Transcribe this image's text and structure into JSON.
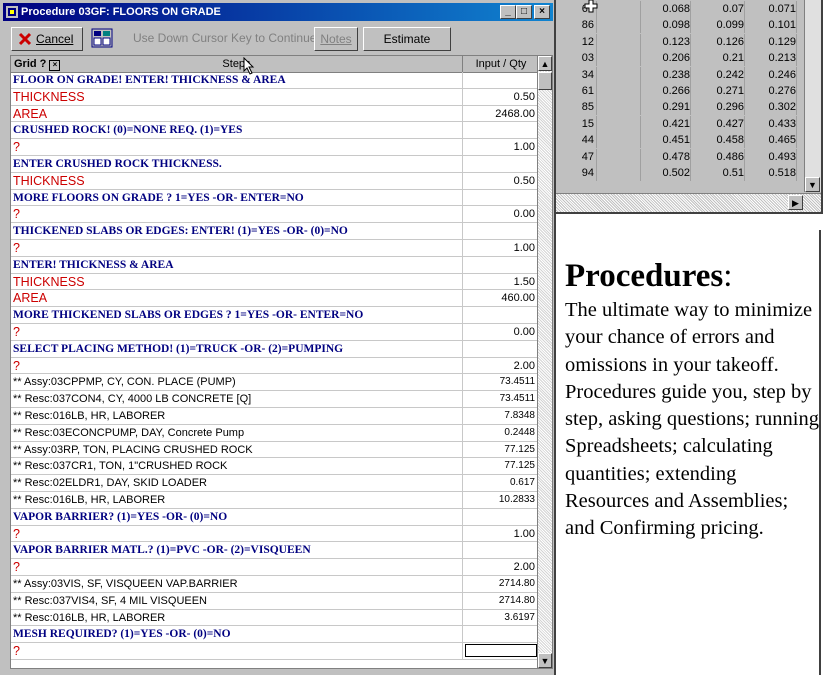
{
  "window": {
    "title": "Procedure 03GF: FLOORS ON GRADE",
    "min_label": "_",
    "max_label": "□",
    "close_label": "×"
  },
  "toolbar": {
    "cancel_label": "Cancel",
    "hint": "Use Down Cursor Key to Continue",
    "notes_label": "Notes",
    "estimate_update_label": "Estimate Update"
  },
  "grid": {
    "label": "Grid ?",
    "col_steps": "Steps",
    "col_qty": "Input / Qty",
    "rows": [
      {
        "type": "q",
        "step": "FLOOR ON GRADE!  ENTER! THICKNESS & AREA",
        "qty": ""
      },
      {
        "type": "r",
        "step": "THICKNESS",
        "qty": "0.50"
      },
      {
        "type": "r",
        "step": "AREA",
        "qty": "2468.00"
      },
      {
        "type": "q",
        "step": "CRUSHED ROCK!  (0)=NONE REQ.  (1)=YES",
        "qty": ""
      },
      {
        "type": "r",
        "step": "?",
        "qty": "1.00"
      },
      {
        "type": "q",
        "step": "ENTER CRUSHED ROCK THICKNESS.",
        "qty": ""
      },
      {
        "type": "r",
        "step": "THICKNESS",
        "qty": "0.50"
      },
      {
        "type": "q",
        "step": "MORE FLOORS ON GRADE ? 1=YES  -OR-  ENTER=NO",
        "qty": ""
      },
      {
        "type": "r",
        "step": "?",
        "qty": "0.00"
      },
      {
        "type": "q",
        "step": "THICKENED SLABS OR EDGES:  ENTER! (1)=YES   -OR-   (0)=NO",
        "qty": ""
      },
      {
        "type": "r",
        "step": "?",
        "qty": "1.00"
      },
      {
        "type": "q",
        "step": "ENTER!  THICKNESS & AREA",
        "qty": ""
      },
      {
        "type": "r",
        "step": "THICKNESS",
        "qty": "1.50"
      },
      {
        "type": "r",
        "step": "AREA",
        "qty": "460.00"
      },
      {
        "type": "q",
        "step": "MORE THICKENED SLABS OR EDGES ? 1=YES  -OR-  ENTER=NO",
        "qty": ""
      },
      {
        "type": "r",
        "step": "?",
        "qty": "0.00"
      },
      {
        "type": "q",
        "step": "SELECT PLACING METHOD!  (1)=TRUCK   -OR-   (2)=PUMPING",
        "qty": ""
      },
      {
        "type": "r",
        "step": "?",
        "qty": "2.00"
      },
      {
        "type": "a",
        "step": "** Assy:03CPPMP, CY, CON. PLACE (PUMP)",
        "qty": "73.4511"
      },
      {
        "type": "a",
        "step": "** Resc:037CON4, CY, 4000 LB CONCRETE [Q]",
        "qty": "73.4511"
      },
      {
        "type": "a",
        "step": "** Resc:016LB, HR, LABORER",
        "qty": "7.8348"
      },
      {
        "type": "a",
        "step": "** Resc:03ECONCPUMP, DAY, Concrete Pump",
        "qty": "0.2448"
      },
      {
        "type": "a",
        "step": "** Assy:03RP, TON, PLACING CRUSHED ROCK",
        "qty": "77.125"
      },
      {
        "type": "a",
        "step": "** Resc:037CR1, TON, 1\"CRUSHED ROCK",
        "qty": "77.125"
      },
      {
        "type": "a",
        "step": "** Resc:02ELDR1, DAY, SKID LOADER",
        "qty": "0.617"
      },
      {
        "type": "a",
        "step": "** Resc:016LB, HR, LABORER",
        "qty": "10.2833"
      },
      {
        "type": "q",
        "step": "VAPOR BARRIER?  (1)=YES   -OR-   (0)=NO",
        "qty": ""
      },
      {
        "type": "r",
        "step": "?",
        "qty": "1.00"
      },
      {
        "type": "q",
        "step": "VAPOR BARRIER MATL.?  (1)=PVC   -OR-   (2)=VISQUEEN",
        "qty": ""
      },
      {
        "type": "r",
        "step": "?",
        "qty": "2.00"
      },
      {
        "type": "a",
        "step": "** Assy:03VIS, SF, VISQUEEN VAP.BARRIER",
        "qty": "2714.80"
      },
      {
        "type": "a",
        "step": "** Resc:037VIS4, SF, 4 MIL VISQUEEN",
        "qty": "2714.80"
      },
      {
        "type": "a",
        "step": "** Resc:016LB, HR, LABORER",
        "qty": "3.6197"
      },
      {
        "type": "q",
        "step": "MESH REQUIRED?  (1)=YES   -OR-   (0)=NO",
        "qty": ""
      },
      {
        "type": "r",
        "step": "?",
        "qty": "",
        "edit": true
      }
    ]
  },
  "background_sheet": {
    "rows": [
      {
        "c0": "67",
        "c1": "0.068",
        "c2": "0.07",
        "c3": "0.071"
      },
      {
        "c0": "86",
        "c1": "0.098",
        "c2": "0.099",
        "c3": "0.101"
      },
      {
        "c0": "12",
        "c1": "0.123",
        "c2": "0.126",
        "c3": "0.129"
      },
      {
        "c0": "03",
        "c1": "0.206",
        "c2": "0.21",
        "c3": "0.213"
      },
      {
        "c0": "34",
        "c1": "0.238",
        "c2": "0.242",
        "c3": "0.246"
      },
      {
        "c0": "61",
        "c1": "0.266",
        "c2": "0.271",
        "c3": "0.276"
      },
      {
        "c0": "85",
        "c1": "0.291",
        "c2": "0.296",
        "c3": "0.302"
      },
      {
        "c0": "15",
        "c1": "0.421",
        "c2": "0.427",
        "c3": "0.433"
      },
      {
        "c0": "44",
        "c1": "0.451",
        "c2": "0.458",
        "c3": "0.465"
      },
      {
        "c0": "47",
        "c1": "0.478",
        "c2": "0.486",
        "c3": "0.493"
      },
      {
        "c0": "94",
        "c1": "0.502",
        "c2": "0.51",
        "c3": "0.518"
      }
    ]
  },
  "info": {
    "title": "Procedures",
    "colon": ":",
    "text": "The ultimate way to minimize your chance of errors and omissions in your takeoff. Procedures guide you, step by step, asking questions; running Spreadsheets; calculating quantities; extending Resources and Assemblies; and Confirming pricing."
  },
  "colors": {
    "question": "#000080",
    "prompt": "#cc0000",
    "titlebar": "#000080"
  }
}
